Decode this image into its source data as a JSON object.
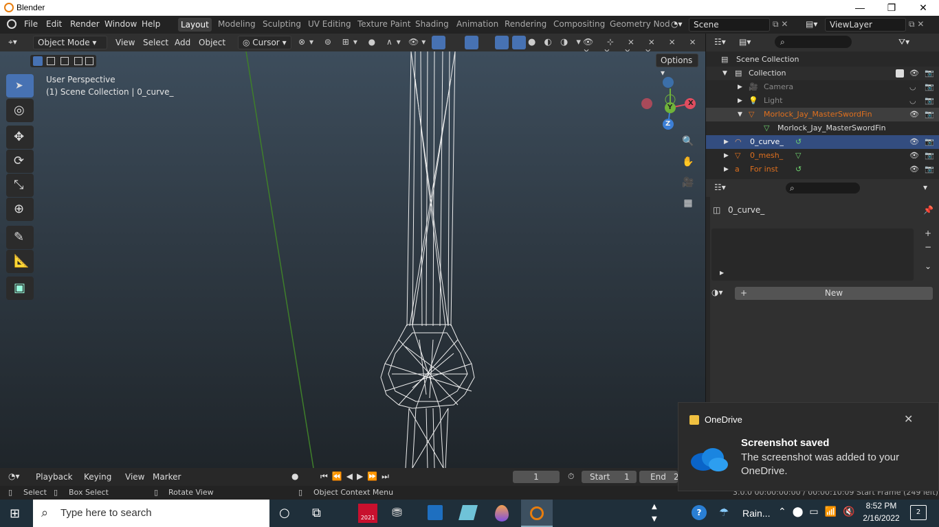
{
  "window": {
    "title": "Blender",
    "min": "—",
    "max": "❐",
    "close": "✕"
  },
  "menu": [
    "File",
    "Edit",
    "Render",
    "Window",
    "Help"
  ],
  "workspaces": [
    "Layout",
    "Modeling",
    "Sculpting",
    "UV Editing",
    "Texture Paint",
    "Shading",
    "Animation",
    "Rendering",
    "Compositing",
    "Geometry Nod"
  ],
  "scene": {
    "name": "Scene",
    "view_layer": "ViewLayer"
  },
  "header3d": {
    "mode": "Object Mode",
    "menus": [
      "View",
      "Select",
      "Add",
      "Object"
    ],
    "pivot": "Cursor"
  },
  "viewport": {
    "perspective": "User Perspective",
    "collection_info": "(1) Scene Collection | 0_curve_",
    "options": "Options",
    "axis_x": "X",
    "axis_y": "Y",
    "axis_z": "Z"
  },
  "outliner": {
    "root": "Scene Collection",
    "collection": "Collection",
    "items": [
      {
        "label": "Camera",
        "color": "#9a8a7a"
      },
      {
        "label": "Light",
        "color": "#9a8a7a"
      },
      {
        "label": "Morlock_Jay_MasterSwordFin",
        "color": "#e0701e"
      },
      {
        "label": "Morlock_Jay_MasterSwordFin",
        "color": "#dddddd"
      },
      {
        "label": "0_curve_",
        "color": "#ffffff"
      },
      {
        "label": "0_mesh_",
        "color": "#e0701e"
      },
      {
        "label": "For inst",
        "color": "#e0701e"
      }
    ]
  },
  "properties": {
    "object": "0_curve_",
    "new_button": "New"
  },
  "timeline": {
    "menus": [
      "Playback",
      "Keying",
      "View",
      "Marker"
    ],
    "frame": "1",
    "start_label": "Start",
    "start": "1",
    "end_label": "End",
    "end": "2"
  },
  "statusbar": {
    "select": "Select",
    "box_select": "Box Select",
    "rotate": "Rotate View",
    "context": "Object Context Menu",
    "info": "3.0.0  00:00:00:00 / 00:00:10:09  Start Frame (249 left)"
  },
  "toast": {
    "app": "OneDrive",
    "title": "Screenshot saved",
    "body": "The screenshot was added to your OneDrive."
  },
  "taskbar": {
    "search": "Type here to search",
    "weather": "Rain...",
    "time": "8:52 PM",
    "date": "2/16/2022",
    "sw_year": "2021",
    "notifications": "2"
  }
}
